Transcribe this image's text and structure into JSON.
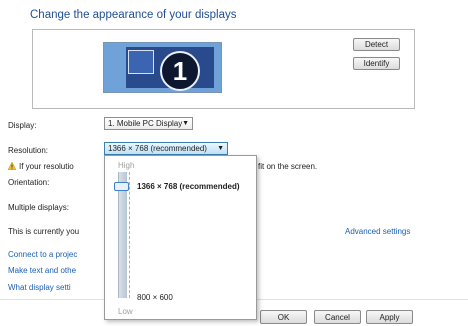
{
  "title": "Change the appearance of your displays",
  "monitor_number": "1",
  "buttons": {
    "detect": "Detect",
    "identify": "Identify",
    "ok": "OK",
    "cancel": "Cancel",
    "apply": "Apply"
  },
  "display": {
    "label": "Display:",
    "value": "1. Mobile PC Display"
  },
  "resolution": {
    "label": "Resolution:",
    "value": "1366 × 768 (recommended)",
    "popup": {
      "high": "High",
      "low": "Low",
      "current": "1366 × 768 (recommended)",
      "min": "800 × 600"
    },
    "slider_level": 1.0
  },
  "warning": {
    "text_left": "If your resolutio",
    "text_right": "fit on the screen."
  },
  "orientation": {
    "label": "Orientation:"
  },
  "multiple_displays": {
    "label": "Multiple displays:"
  },
  "status": {
    "text": "This is currently you"
  },
  "advanced": "Advanced settings",
  "links": [
    "Connect to a projec",
    "Make text and othe",
    "What display setti"
  ]
}
